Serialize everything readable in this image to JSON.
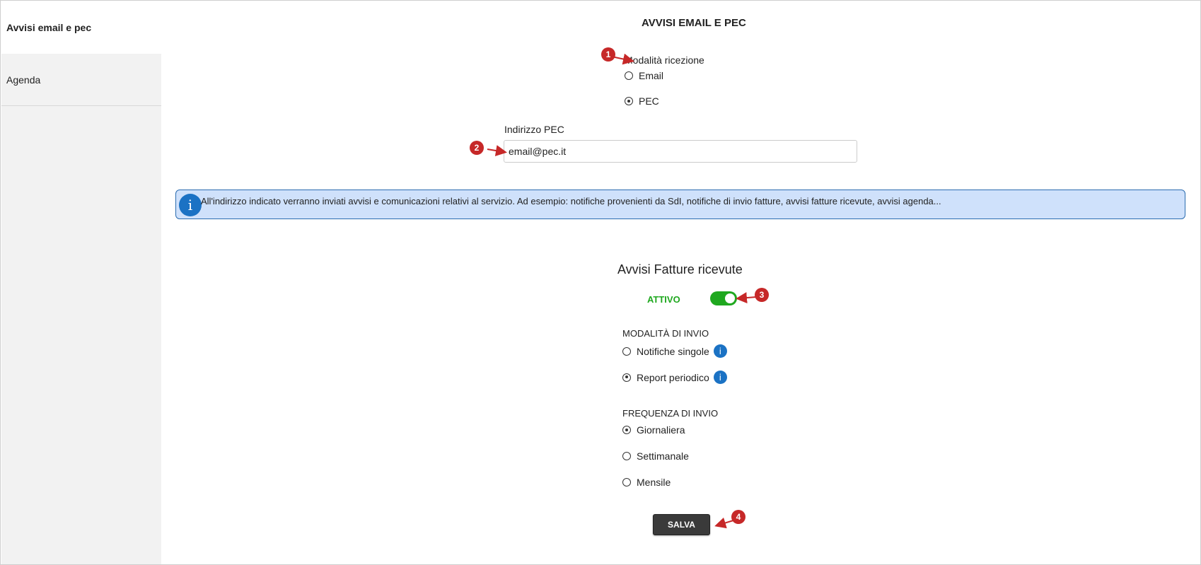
{
  "sidebar": {
    "items": [
      {
        "label": "Avvisi email e pec"
      },
      {
        "label": "Agenda"
      }
    ]
  },
  "main": {
    "title": "AVVISI EMAIL E PEC",
    "reception": {
      "label": "Modalità ricezione",
      "options": [
        {
          "label": "Email",
          "selected": false
        },
        {
          "label": "PEC",
          "selected": true
        }
      ]
    },
    "pec": {
      "label": "Indirizzo PEC",
      "value": "email@pec.it"
    },
    "info_banner": {
      "icon": "i",
      "text": "All'indirizzo indicato verranno inviati avvisi e comunicazioni relativi al servizio. Ad esempio: notifiche provenienti da SdI, notifiche di invio fatture, avvisi fatture ricevute, avvisi agenda..."
    },
    "invoices": {
      "title": "Avvisi Fatture ricevute",
      "status_label": "ATTIVO",
      "toggle_on": true,
      "send_mode": {
        "label": "MODALITÀ DI INVIO",
        "options": [
          {
            "label": "Notifiche singole",
            "selected": false
          },
          {
            "label": "Report periodico",
            "selected": true
          }
        ]
      },
      "frequency": {
        "label": "FREQUENZA DI INVIO",
        "options": [
          {
            "label": "Giornaliera",
            "selected": true
          },
          {
            "label": "Settimanale",
            "selected": false
          },
          {
            "label": "Mensile",
            "selected": false
          }
        ]
      }
    },
    "save_label": "SALVA",
    "info_icon_glyph": "i"
  },
  "markers": [
    "1",
    "2",
    "3",
    "4"
  ],
  "colors": {
    "toggle_on": "#1fa81f",
    "status_text": "#1fa81f",
    "info_blue": "#1b72c4",
    "banner_bg": "#cfe1fb",
    "marker_red": "#c62828",
    "save_bg": "#3a3a3a"
  }
}
